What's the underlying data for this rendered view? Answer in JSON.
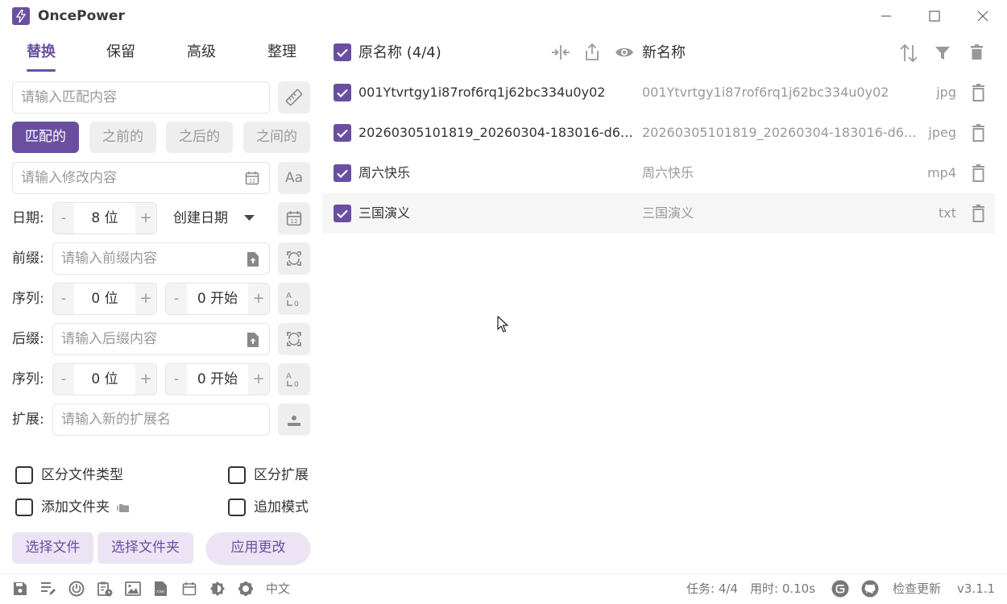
{
  "app": {
    "title": "OncePower",
    "version": "v3.1.1"
  },
  "tabs": [
    "替换",
    "保留",
    "高级",
    "整理"
  ],
  "match_input": {
    "placeholder": "请输入匹配内容"
  },
  "modes": [
    "匹配的",
    "之前的",
    "之后的",
    "之间的"
  ],
  "modify_input": {
    "placeholder": "请输入修改内容"
  },
  "date_row": {
    "label": "日期:",
    "digits": "8 位",
    "type": "创建日期"
  },
  "prefix_row": {
    "label": "前缀:",
    "placeholder": "请输入前缀内容"
  },
  "prefix_seq": {
    "label": "序列:",
    "digits": "0 位",
    "start": "0 开始"
  },
  "suffix_row": {
    "label": "后缀:",
    "placeholder": "请输入后缀内容"
  },
  "suffix_seq": {
    "label": "序列:",
    "digits": "0 位",
    "start": "0 开始"
  },
  "ext_row": {
    "label": "扩展:",
    "placeholder": "请输入新的扩展名"
  },
  "options": {
    "distinguish_type": "区分文件类型",
    "distinguish_ext": "区分扩展",
    "add_folder": "添加文件夹",
    "append_mode": "追加模式"
  },
  "buttons": {
    "select_files": "选择文件",
    "select_folder": "选择文件夹",
    "apply": "应用更改"
  },
  "list_header": {
    "original": "原名称 (4/4)",
    "new": "新名称"
  },
  "files": [
    {
      "original": "001Ytvrtgy1i87rof6rq1j62bc334u0y02",
      "new": "001Ytvrtgy1i87rof6rq1j62bc334u0y02",
      "ext": "jpg"
    },
    {
      "original": "20260305101819_20260304-183016-d67...",
      "new": "20260305101819_20260304-183016-d67...",
      "ext": "jpeg"
    },
    {
      "original": "周六快乐",
      "new": "周六快乐",
      "ext": "mp4"
    },
    {
      "original": "三国演义",
      "new": "三国演义",
      "ext": "txt"
    }
  ],
  "status": {
    "language": "中文",
    "tasks": "任务: 4/4",
    "time": "用时: 0.10s",
    "check_update": "检查更新"
  },
  "colors": {
    "accent": "#6a4fa1",
    "accent_light": "#ece4f4"
  }
}
